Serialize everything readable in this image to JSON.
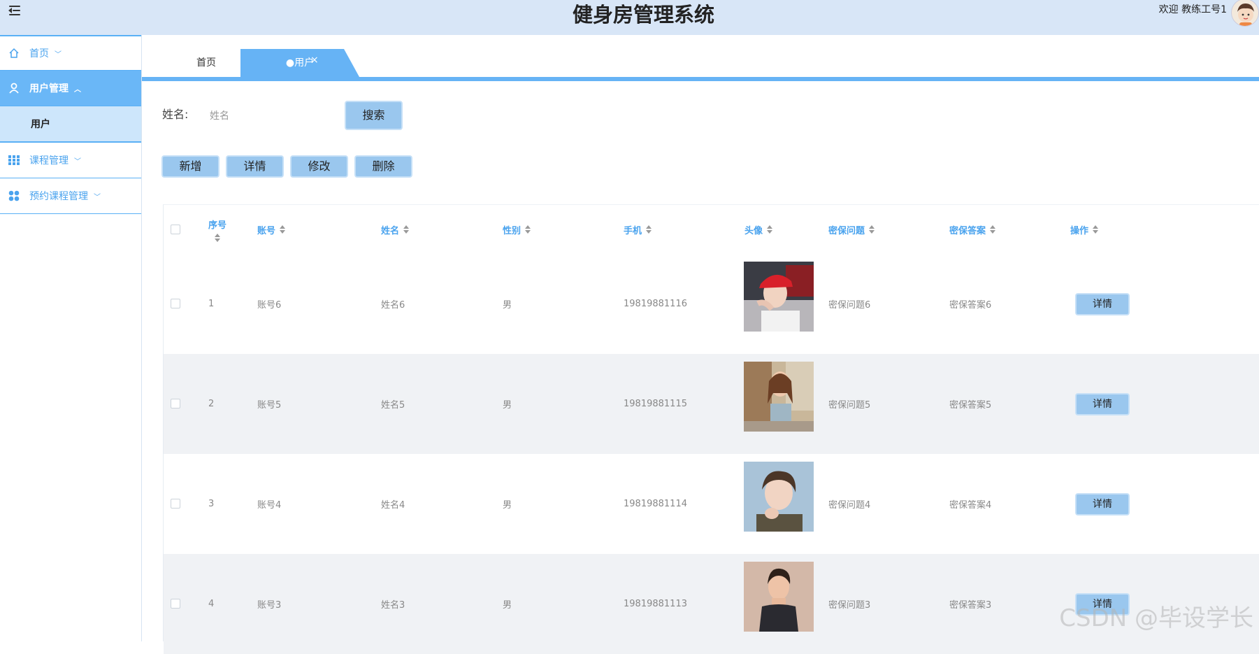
{
  "header": {
    "title": "健身房管理系统",
    "welcome": "欢迎 教练工号1"
  },
  "sidebar": {
    "items": [
      {
        "label": "首页",
        "icon": "home-icon",
        "chevron": "﹀"
      },
      {
        "label": "用户管理",
        "icon": "user-icon",
        "chevron": "︿"
      },
      {
        "label": "用户"
      },
      {
        "label": "课程管理",
        "icon": "grid-icon",
        "chevron": "﹀"
      },
      {
        "label": "预约课程管理",
        "icon": "apps-icon",
        "chevron": "﹀"
      }
    ]
  },
  "tabs": [
    {
      "label": "首页"
    },
    {
      "label": "●用户",
      "close": "×"
    }
  ],
  "search": {
    "label": "姓名:",
    "placeholder": "姓名",
    "button": "搜索"
  },
  "actions": {
    "add": "新增",
    "detail": "详情",
    "edit": "修改",
    "delete": "删除"
  },
  "table": {
    "columns": [
      "序号",
      "账号",
      "姓名",
      "性别",
      "手机",
      "头像",
      "密保问题",
      "密保答案",
      "操作"
    ],
    "rows": [
      {
        "idx": "1",
        "account": "账号6",
        "name": "姓名6",
        "gender": "男",
        "phone": "19819881116",
        "question": "密保问题6",
        "answer": "密保答案6",
        "action": "详情"
      },
      {
        "idx": "2",
        "account": "账号5",
        "name": "姓名5",
        "gender": "男",
        "phone": "19819881115",
        "question": "密保问题5",
        "answer": "密保答案5",
        "action": "详情"
      },
      {
        "idx": "3",
        "account": "账号4",
        "name": "姓名4",
        "gender": "男",
        "phone": "19819881114",
        "question": "密保问题4",
        "answer": "密保答案4",
        "action": "详情"
      },
      {
        "idx": "4",
        "account": "账号3",
        "name": "姓名3",
        "gender": "男",
        "phone": "19819881113",
        "question": "密保问题3",
        "answer": "密保答案3",
        "action": "详情"
      }
    ]
  },
  "watermark": "CSDN @毕设学长",
  "colors": {
    "header_bg": "#d8e6f7",
    "accent": "#66b3f5",
    "button": "#9ac7ee",
    "link": "#4aa3ee"
  }
}
